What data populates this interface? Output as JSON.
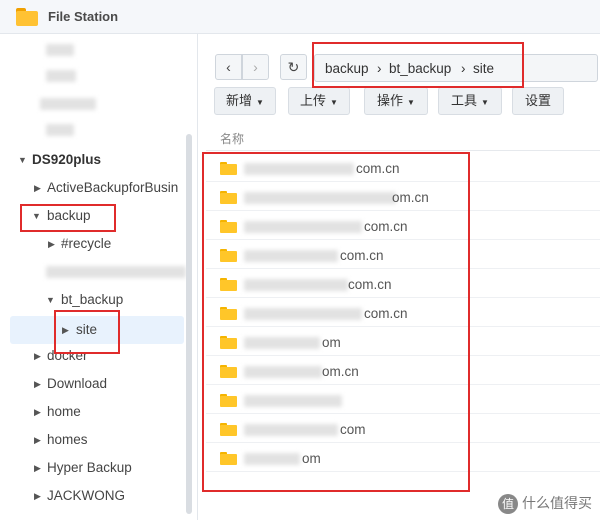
{
  "window": {
    "title": "File Station"
  },
  "sidebar": {
    "root": "DS920plus",
    "items": [
      {
        "label": "ActiveBackupforBusin"
      },
      {
        "label": "backup"
      },
      {
        "label": "#recycle"
      },
      {
        "label": "bt_backup"
      },
      {
        "label": "site"
      },
      {
        "label": "docker"
      },
      {
        "label": "Download"
      },
      {
        "label": "home"
      },
      {
        "label": "homes"
      },
      {
        "label": "Hyper Backup"
      },
      {
        "label": "JACKWONG"
      }
    ]
  },
  "breadcrumb": {
    "parts": [
      "backup",
      "bt_backup",
      "site"
    ],
    "separator": "›"
  },
  "toolbar": {
    "back": "‹",
    "forward": "›",
    "refresh": "↻",
    "buttons": [
      "新增",
      "上传",
      "操作",
      "工具",
      "设置"
    ]
  },
  "file_list": {
    "column_name": "名称",
    "rows": [
      {
        "name_visible": "com.cn"
      },
      {
        "name_visible": "om.cn"
      },
      {
        "name_visible": "com.cn"
      },
      {
        "name_visible": "com.cn"
      },
      {
        "name_visible": "com.cn"
      },
      {
        "name_visible": "com.cn"
      },
      {
        "name_visible": "om"
      },
      {
        "name_visible": "om.cn"
      },
      {
        "name_visible": ""
      },
      {
        "name_visible": "com"
      },
      {
        "name_visible": "om"
      }
    ]
  },
  "watermark": {
    "badge": "值",
    "text": "什么值得买"
  },
  "colors": {
    "accent_red": "#e02b2b",
    "folder_yellow": "#ffc629",
    "selected_bg": "#e8f2fd"
  }
}
